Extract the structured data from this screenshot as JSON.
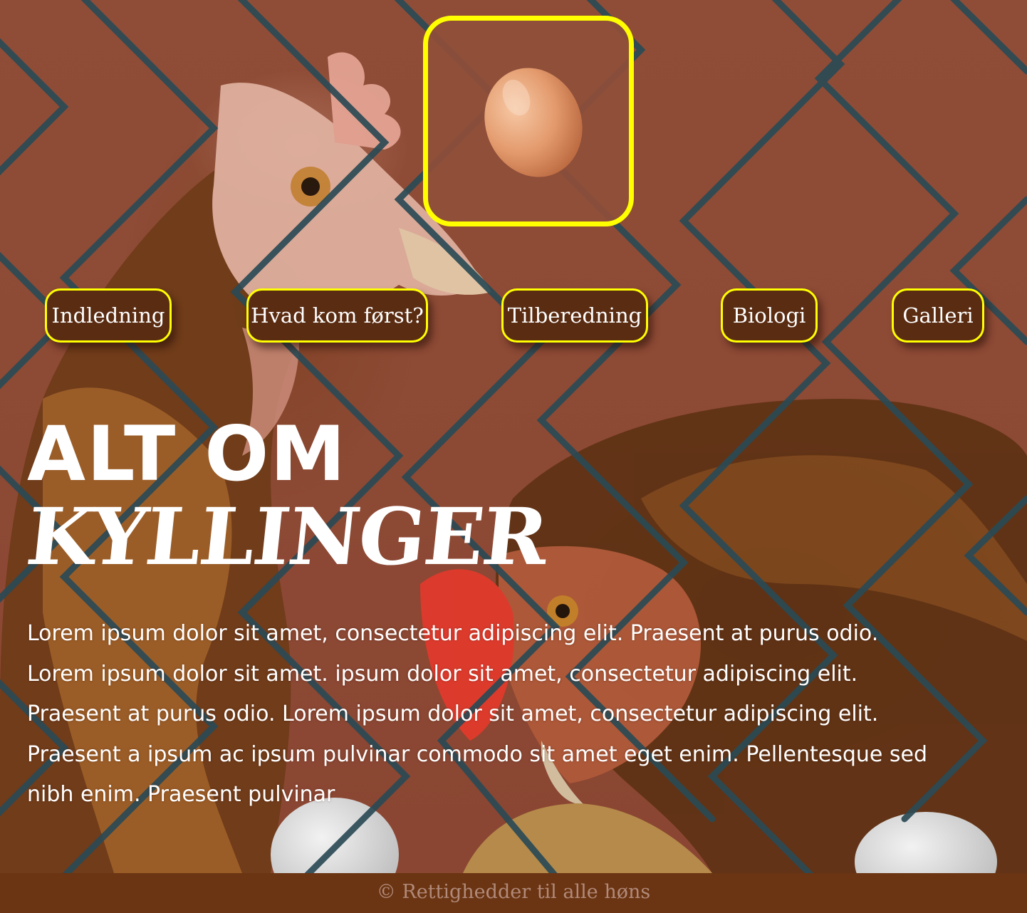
{
  "logo": {
    "icon": "egg-icon"
  },
  "nav": {
    "items": [
      {
        "label": "Indledning"
      },
      {
        "label": "Hvad kom først?"
      },
      {
        "label": "Tilberedning"
      },
      {
        "label": "Biologi"
      },
      {
        "label": "Galleri"
      }
    ]
  },
  "hero": {
    "title_line1": "ALT OM",
    "title_line2": "KYLLINGER",
    "intro": "Lorem ipsum dolor sit amet, consectetur adipiscing elit. Praesent at purus odio. Lorem ipsum dolor sit amet. ipsum dolor sit amet, consectetur adipiscing elit. Praesent at purus odio. Lorem ipsum dolor sit amet, consectetur adipiscing elit. Praesent a ipsum ac ipsum pulvinar commodo sit amet eget enim. Pellentesque sed nibh enim. Praesent pulvinar"
  },
  "footer": {
    "text": "© Rettighedder til alle høns"
  },
  "colors": {
    "background": "#8c4a35",
    "accent_border": "#ffff00",
    "nav_button": "#5a2c12",
    "footer_bg": "#6b3412",
    "footer_text": "#b08a7a",
    "fence": "#2b4a55"
  }
}
